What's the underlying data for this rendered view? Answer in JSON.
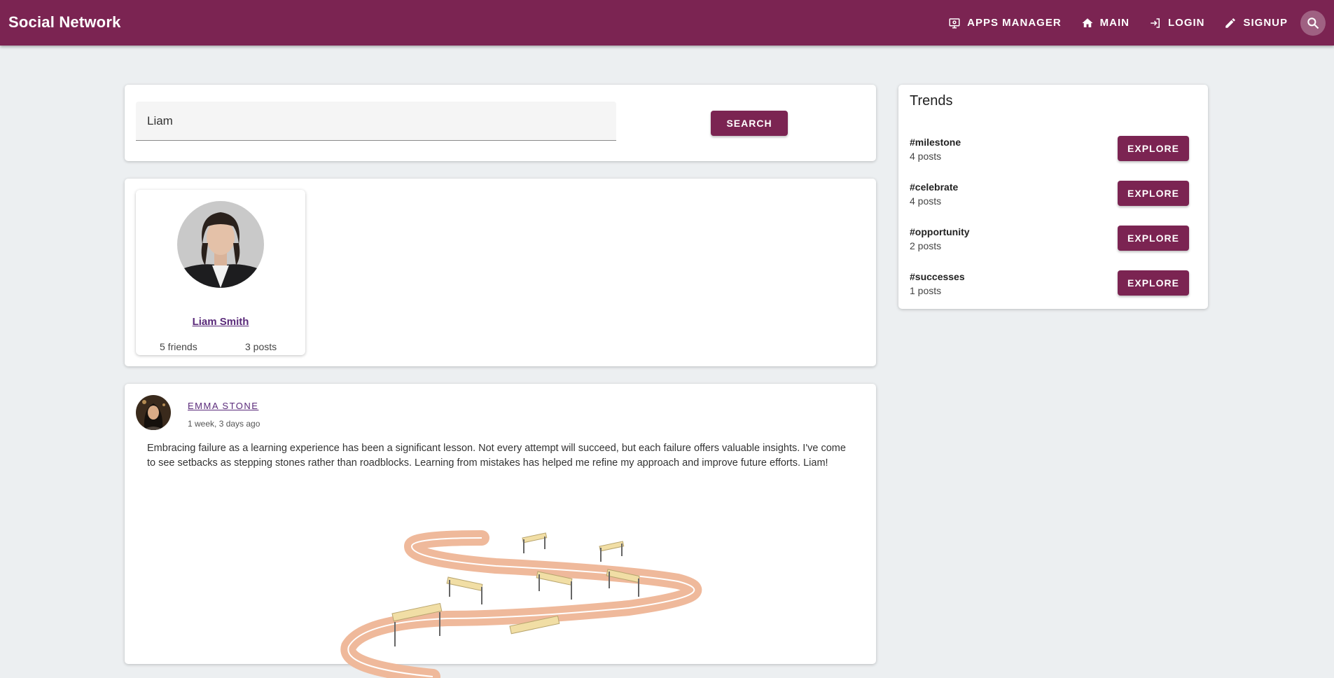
{
  "app": {
    "title": "Social Network"
  },
  "nav": {
    "apps_manager": "APPS MANAGER",
    "main": "MAIN",
    "login": "LOGIN",
    "signup": "SIGNUP"
  },
  "search": {
    "value": "Liam",
    "button": "SEARCH"
  },
  "results": [
    {
      "name": "Liam Smith",
      "friends": "5 friends",
      "posts": "3 posts"
    }
  ],
  "post": {
    "author": "EMMA STONE",
    "time": "1 week, 3 days ago",
    "text": "Embracing failure as a learning experience has been a significant lesson. Not every attempt will succeed, but each failure offers valuable insights. I've come to see setbacks as stepping stones rather than roadblocks. Learning from mistakes has helped me refine my approach and improve future efforts. Liam!"
  },
  "trends": {
    "title": "Trends",
    "items": [
      {
        "tag": "#milestone",
        "count": "4 posts",
        "button": "EXPLORE"
      },
      {
        "tag": "#celebrate",
        "count": "4 posts",
        "button": "EXPLORE"
      },
      {
        "tag": "#opportunity",
        "count": "2 posts",
        "button": "EXPLORE"
      },
      {
        "tag": "#successes",
        "count": "1 posts",
        "button": "EXPLORE"
      }
    ]
  },
  "colors": {
    "primary": "#7b2452",
    "background": "#eceff1",
    "link": "#5a2a7a"
  }
}
